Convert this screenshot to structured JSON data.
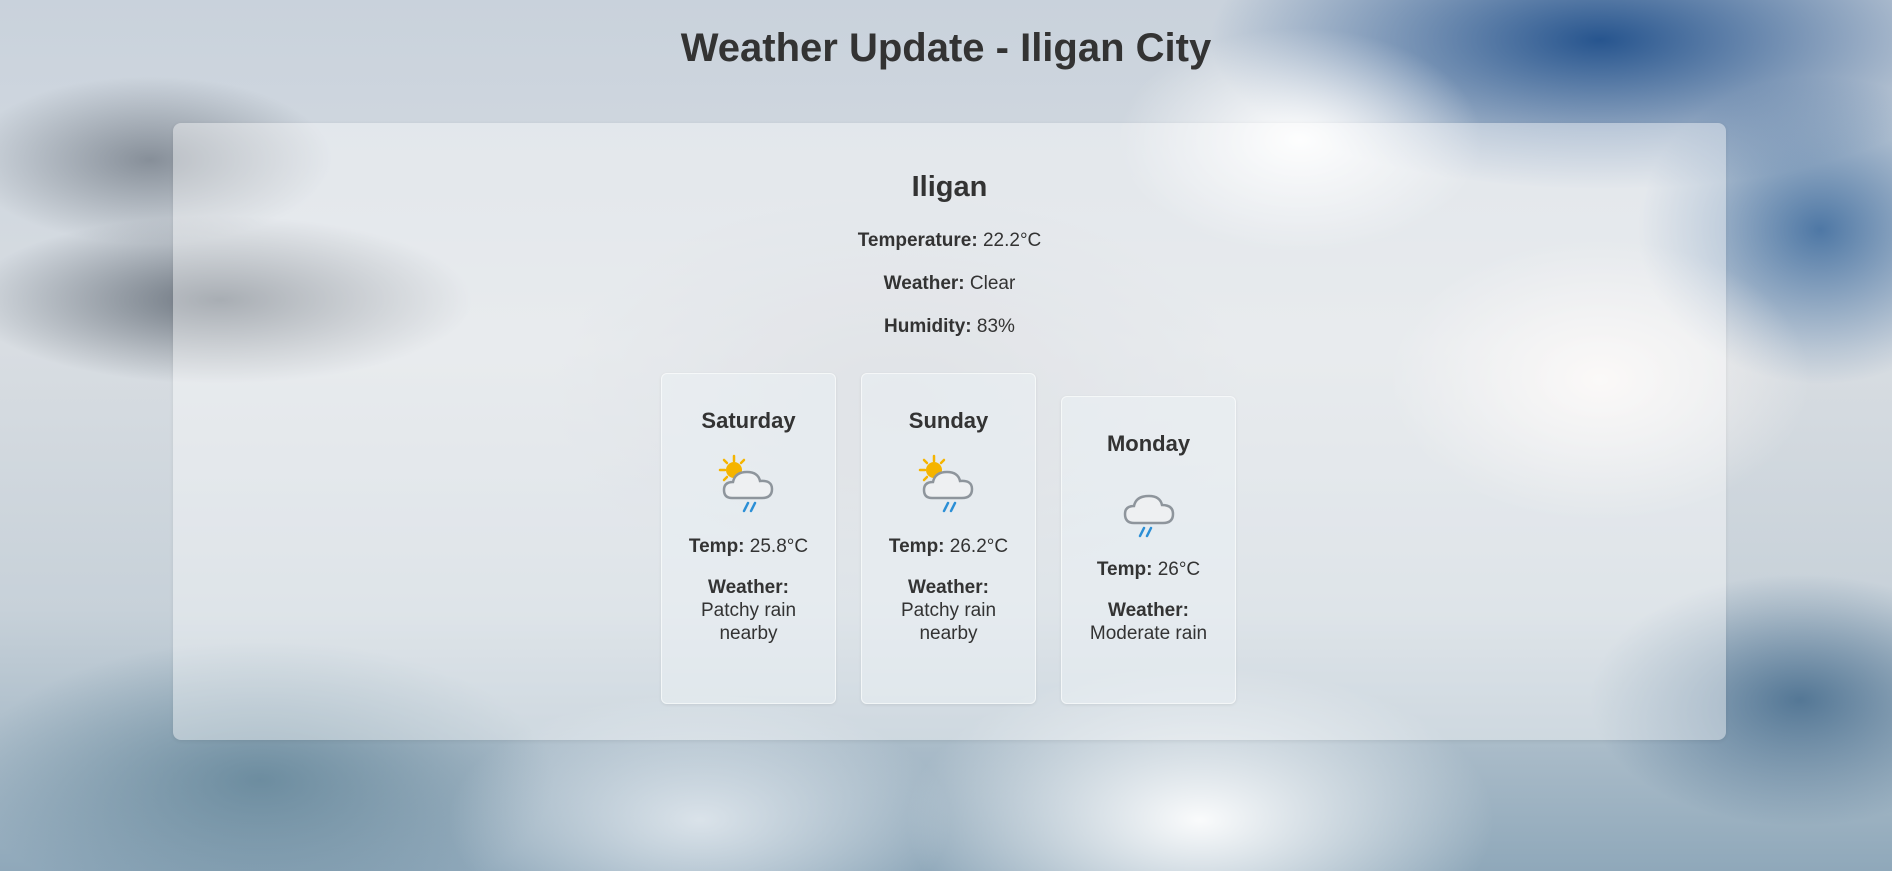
{
  "page": {
    "title": "Weather Update - Iligan City"
  },
  "current": {
    "city": "Iligan",
    "temperature_label": "Temperature:",
    "temperature_value": "22.2°C",
    "weather_label": "Weather:",
    "weather_value": "Clear",
    "humidity_label": "Humidity:",
    "humidity_value": "83%"
  },
  "forecast": [
    {
      "day": "Saturday",
      "icon": "patchy-rain-sun-icon",
      "temp_label": "Temp:",
      "temp_value": "25.8°C",
      "weather_label": "Weather:",
      "weather_value": "Patchy rain nearby"
    },
    {
      "day": "Sunday",
      "icon": "patchy-rain-sun-icon",
      "temp_label": "Temp:",
      "temp_value": "26.2°C",
      "weather_label": "Weather:",
      "weather_value": "Patchy rain nearby"
    },
    {
      "day": "Monday",
      "icon": "rain-cloud-icon",
      "temp_label": "Temp:",
      "temp_value": "26°C",
      "weather_label": "Weather:",
      "weather_value": "Moderate rain"
    }
  ],
  "colors": {
    "text": "#333333",
    "sun": "#f5b400",
    "cloud_fill": "#eef0f2",
    "cloud_stroke": "#8e959c",
    "rain": "#2b8fd6"
  }
}
